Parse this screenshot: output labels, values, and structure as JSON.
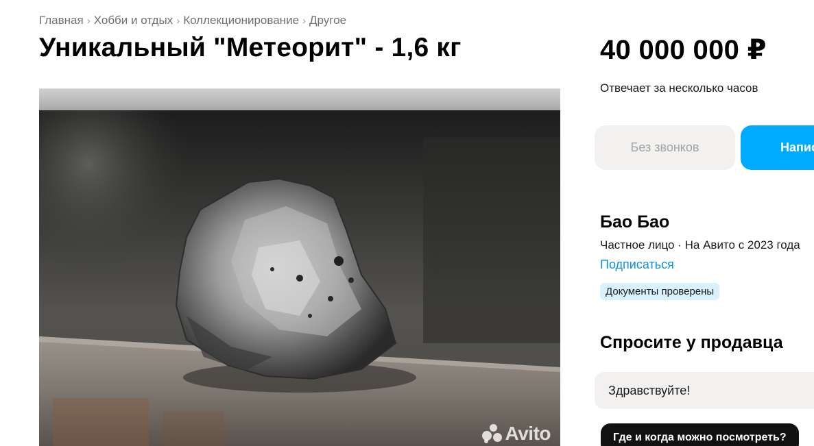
{
  "breadcrumbs": [
    "Главная",
    "Хобби и отдых",
    "Коллекционирование",
    "Другое"
  ],
  "breadcrumb_separator": "›",
  "listing": {
    "title": "Уникальный \"Метеорит\" - 1,6 кг",
    "price": "40 000 000 ₽",
    "reply_time": "Отвечает за несколько часов",
    "photo_watermark": "Avito"
  },
  "actions": {
    "no_calls_label": "Без звонков",
    "write_label": "Написать"
  },
  "seller": {
    "name": "Бао Бао",
    "meta": "Частное лицо · На Авито с 2023 года",
    "subscribe_label": "Подписаться",
    "badge": "Документы проверены"
  },
  "ask_seller": {
    "title": "Спросите у продавца",
    "input_value": "Здравствуйте!",
    "quick_question": "Где и когда можно посмотреть?"
  },
  "colors": {
    "accent": "#00aaff",
    "link": "#0a8ee8",
    "badge_bg": "#d9f1fd",
    "button_gray": "#f2f1f0"
  }
}
